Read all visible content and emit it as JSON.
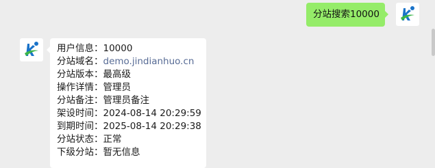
{
  "colors": {
    "background": "#ededed",
    "sent_bubble": "#95ec69",
    "received_bubble": "#ffffff",
    "link": "#576b95",
    "logo_blue": "#1a73c9",
    "logo_green": "#3bb54a"
  },
  "avatars": {
    "bot_icon": "jindianhuo-logo-icon",
    "user_icon": "jindianhuo-logo-icon"
  },
  "sent_message": {
    "text": "分站搜索10000"
  },
  "reply": {
    "rows": [
      {
        "label": "用户信息：",
        "value": "10000"
      },
      {
        "label": "分站域名：",
        "value": "demo.jindianhuo.cn",
        "link": true
      },
      {
        "label": "分站版本：",
        "value": "最高级"
      },
      {
        "label": "操作详情：",
        "value": "管理员"
      },
      {
        "label": "分站备注：",
        "value": "管理员备注"
      },
      {
        "label": "架设时间：",
        "value": "2024-08-14 20:29:59"
      },
      {
        "label": "到期时间：",
        "value": "2025-08-14 20:29:38"
      },
      {
        "label": "分站状态：",
        "value": "正常"
      },
      {
        "label": "下级分站：",
        "value": "暂无信息"
      }
    ]
  }
}
